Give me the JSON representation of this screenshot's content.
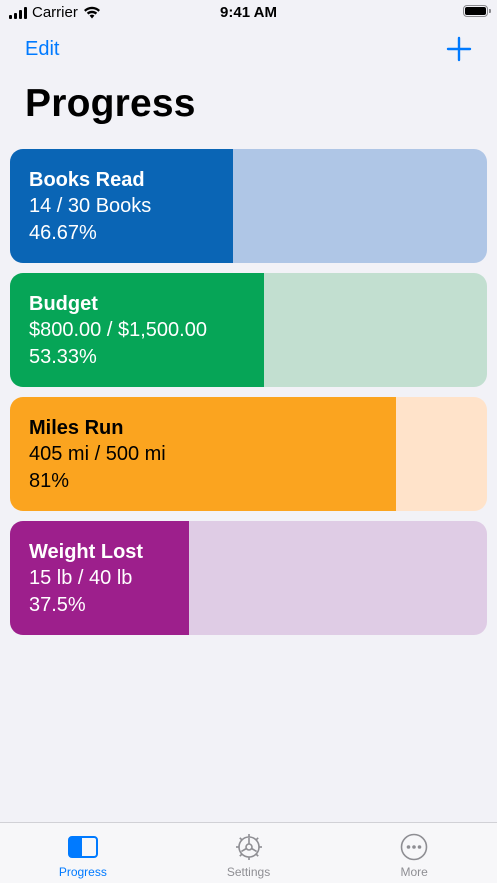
{
  "status_bar": {
    "carrier": "Carrier",
    "time": "9:41 AM"
  },
  "nav": {
    "edit_label": "Edit",
    "add_icon": "plus-icon"
  },
  "page": {
    "title": "Progress"
  },
  "goals": [
    {
      "title": "Books Read",
      "amount": "14 / 30 Books",
      "percent": "46.67%",
      "progress": 0.4667,
      "fill_color": "#0a65b5",
      "track_color": "#afc6e6",
      "text_color": "#ffffff"
    },
    {
      "title": "Budget",
      "amount": "$800.00 / $1,500.00",
      "percent": "53.33%",
      "progress": 0.5333,
      "fill_color": "#06a557",
      "track_color": "#c2dfd0",
      "text_color": "#ffffff"
    },
    {
      "title": "Miles Run",
      "amount": "405 mi / 500 mi",
      "percent": "81%",
      "progress": 0.81,
      "fill_color": "#fba41f",
      "track_color": "#ffe3ca",
      "text_color": "#000000"
    },
    {
      "title": "Weight Lost",
      "amount": "15 lb / 40 lb",
      "percent": "37.5%",
      "progress": 0.375,
      "fill_color": "#9d1f8c",
      "track_color": "#dfcce5",
      "text_color": "#ffffff"
    }
  ],
  "tabs": [
    {
      "label": "Progress",
      "icon": "sidebar-panel-icon",
      "active": true
    },
    {
      "label": "Settings",
      "icon": "gear-icon",
      "active": false
    },
    {
      "label": "More",
      "icon": "ellipsis-circle-icon",
      "active": false
    }
  ],
  "colors": {
    "accent": "#007aff",
    "background": "#f2f2f7",
    "inactive_tab": "#8e8e93"
  }
}
